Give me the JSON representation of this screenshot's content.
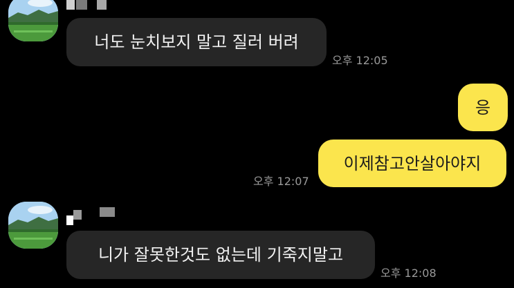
{
  "messages": [
    {
      "side": "in",
      "text": "너도 눈치보지 말고 질러 버려",
      "time": "오후 12:05"
    },
    {
      "side": "out",
      "text": "응",
      "time": ""
    },
    {
      "side": "out",
      "text": "이제참고안살아야지",
      "time": "오후 12:07"
    },
    {
      "side": "in",
      "text": "니가 잘못한것도 없는데 기죽지말고",
      "time": "오후 12:08"
    }
  ],
  "colors": {
    "background": "#000000",
    "incoming_bubble": "#262626",
    "outgoing_bubble": "#fbe54d",
    "timestamp": "#9a9a9a"
  },
  "icons": {
    "avatar": "landscape-avatar-icon"
  }
}
